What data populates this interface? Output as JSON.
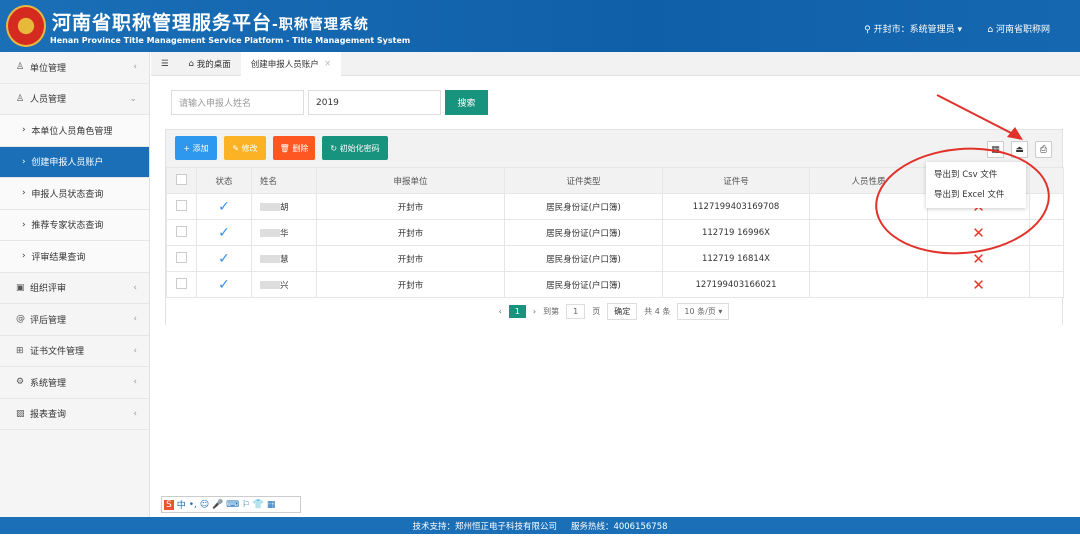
{
  "header": {
    "title": "河南省职称管理服务平台",
    "title_suffix": "-职称管理系统",
    "subtitle": "Henan Province Title Management Service Platform - Title Management System",
    "user": "开封市：系统管理员",
    "site_link": "河南省职称网"
  },
  "sidebar": {
    "items": [
      {
        "label": "单位管理",
        "icon": "user-icon"
      },
      {
        "label": "人员管理",
        "icon": "user-icon"
      },
      {
        "label": "本单位人员角色管理",
        "sub": true
      },
      {
        "label": "创建申报人员账户",
        "sub": true,
        "active": true
      },
      {
        "label": "申报人员状态查询",
        "sub": true
      },
      {
        "label": "推荐专家状态查询",
        "sub": true
      },
      {
        "label": "评审结果查询",
        "sub": true
      },
      {
        "label": "组织评审",
        "icon": "card-icon"
      },
      {
        "label": "评后管理",
        "icon": "at-icon"
      },
      {
        "label": "证书文件管理",
        "icon": "book-icon"
      },
      {
        "label": "系统管理",
        "icon": "gear-icon"
      },
      {
        "label": "报表查询",
        "icon": "image-icon"
      }
    ]
  },
  "tabs": [
    {
      "label": "我的桌面"
    },
    {
      "label": "创建申报人员账户"
    }
  ],
  "search": {
    "name_placeholder": "请输入申报人姓名",
    "year_value": "2019",
    "button": "搜索"
  },
  "toolbar": {
    "add": "添加",
    "edit": "修改",
    "delete": "删除",
    "reset_password": "初始化密码"
  },
  "export_menu": [
    "导出到 Csv 文件",
    "导出到 Excel 文件"
  ],
  "table": {
    "headers": [
      "状态",
      "姓名",
      "申报单位",
      "证件类型",
      "证件号",
      "人员性质",
      ""
    ],
    "rows": [
      {
        "name": "胡",
        "unit": "开封市",
        "id_type": "居民身份证(户口簿)",
        "id_no": "1127199403169708"
      },
      {
        "name": "华",
        "unit": "开封市",
        "id_type": "居民身份证(户口簿)",
        "id_no": "112719  16996X"
      },
      {
        "name": "慧",
        "unit": "开封市",
        "id_type": "居民身份证(户口簿)",
        "id_no": "112719  16814X"
      },
      {
        "name": "兴",
        "unit": "开封市",
        "id_type": "居民身份证(户口簿)",
        "id_no": "127199403166021"
      }
    ]
  },
  "pager": {
    "current": "1",
    "goto_label": "到第",
    "goto_value": "1",
    "page_unit": "页",
    "confirm": "确定",
    "total": "共 4 条",
    "page_size": "10 条/页"
  },
  "ime": {
    "label": "中"
  },
  "footer": {
    "support": "技术支持：郑州恒正电子科技有限公司",
    "hotline": "服务热线：4006156758"
  }
}
